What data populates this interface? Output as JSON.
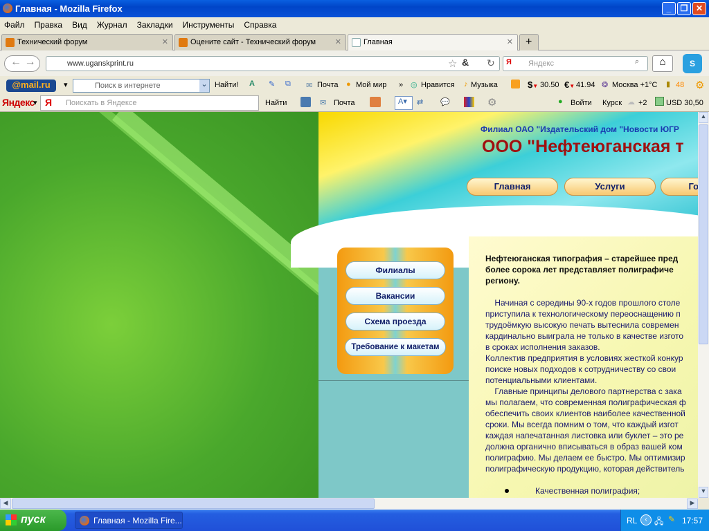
{
  "window": {
    "title": "Главная - Mozilla Firefox"
  },
  "menu": [
    "Файл",
    "Правка",
    "Вид",
    "Журнал",
    "Закладки",
    "Инструменты",
    "Справка"
  ],
  "tabs": [
    {
      "label": "Технический форум"
    },
    {
      "label": "Оцените сайт - Технический форум"
    },
    {
      "label": "Главная"
    }
  ],
  "nav": {
    "url": "www.uganskprint.ru",
    "search_placeholder": "Яндекс"
  },
  "mailbar": {
    "logo": "@mail.ru",
    "search_placeholder": "Поиск в интернете",
    "find": "Найти!",
    "mail": "Почта",
    "myworld": "Мой мир",
    "more": "»",
    "like": "Нравится",
    "music": "Музыка",
    "usd": "30.50",
    "eur": "41.94",
    "weather": "Москва +1°C",
    "traffic": "48"
  },
  "yabar": {
    "logo": "Яндекс",
    "search_placeholder": "Поискать в Яндексе",
    "find": "Найти",
    "mail": "Почта",
    "login": "Войти",
    "city": "Курск",
    "temp": "+2",
    "usd": "USD 30,50"
  },
  "site": {
    "subtitle": "Филиал ОАО \"Издательский дом \"Новости ЮГР",
    "title": "ООО \"Нефтеюганская т",
    "nav": [
      "Главная",
      "Услуги",
      "Готовая"
    ],
    "side": [
      "Филиалы",
      "Вакансии",
      "Схема проезда",
      "Требование к макетам"
    ],
    "lead": [
      "Нефтеюганская типография – старейшее пред",
      "более сорока лет представляет полиграфиче",
      "региону."
    ],
    "body": [
      "    Начиная с середины 90-х годов прошлого столе",
      "приступила к технологическому переоснащению п",
      "трудоёмкую высокую печать вытеснила современ",
      "кардинально выиграла не только в качестве изгото",
      "в сроках исполнения заказов.",
      "Коллектив предприятия в условиях жесткой конкур",
      "поиске новых подходов к сотрудничеству со свои",
      "потенциальными клиентами.",
      "    Главные принципы делового партнерства с зака",
      "мы полагаем, что современная полиграфическая ф",
      "обеспечить своих клиентов наиболее качественной",
      "сроки. Мы всегда помним о том, что каждый изгот",
      "каждая напечатанная листовка или буклет – это ре",
      "должна органично вписываться в образ вашей ком",
      "полиграфию. Мы делаем ее быстро. Мы оптимизир",
      "полиграфическую продукцию, которая действитель"
    ],
    "bullet": "Качественная полиграфия;"
  },
  "taskbar": {
    "start": "пуск",
    "task": "Главная - Mozilla Fire...",
    "lang": "RL",
    "clock": "17:57"
  }
}
